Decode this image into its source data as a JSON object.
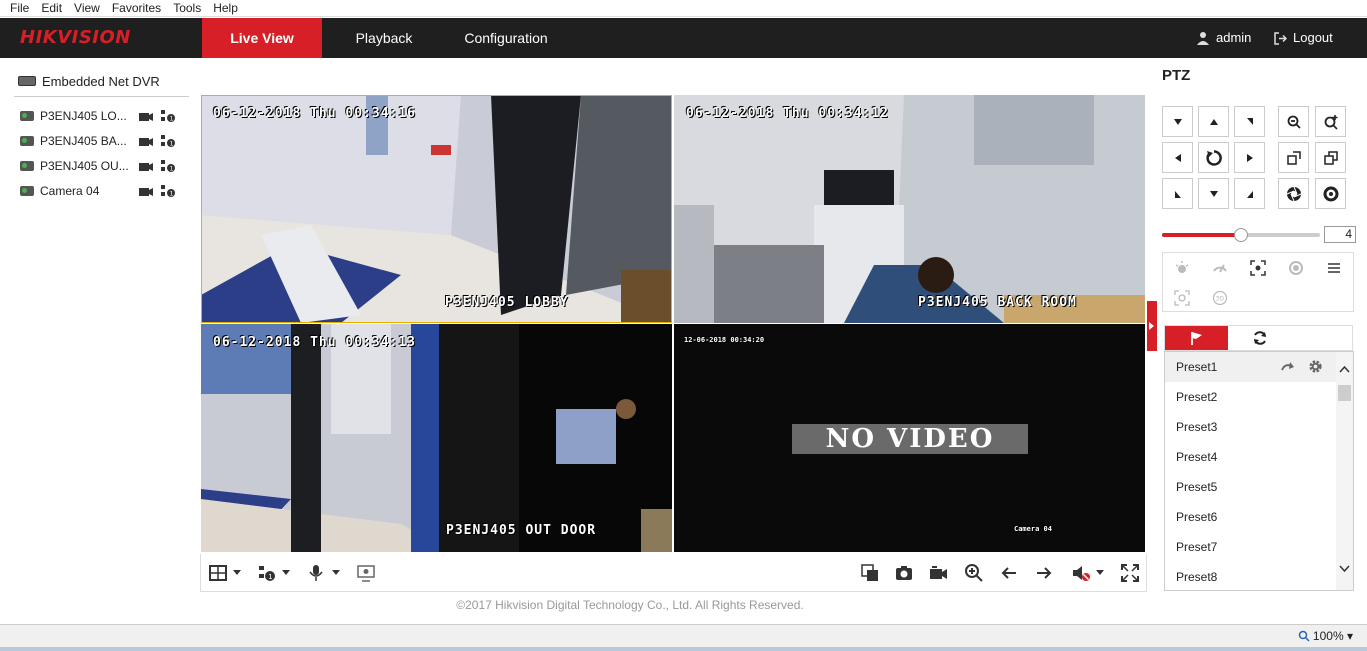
{
  "menubar": {
    "items": [
      "File",
      "Edit",
      "View",
      "Favorites",
      "Tools",
      "Help"
    ]
  },
  "brand": {
    "name": "HIKVISION",
    "accent": "#d61f26",
    "nav_bg": "#1f1f1f"
  },
  "nav": {
    "tabs": [
      {
        "label": "Live View",
        "active": true
      },
      {
        "label": "Playback",
        "active": false
      },
      {
        "label": "Configuration",
        "active": false
      }
    ],
    "user": "admin",
    "logout": "Logout"
  },
  "device_tree": {
    "root": "Embedded Net DVR",
    "cameras": [
      {
        "label": "P3ENJ405 LO..."
      },
      {
        "label": "P3ENJ405 BA..."
      },
      {
        "label": "P3ENJ405 OU..."
      },
      {
        "label": "Camera 04"
      }
    ]
  },
  "tiles": [
    {
      "timestamp": "06-12-2018 Thu 00:34:16",
      "name": "P3ENJ405 LOBBY",
      "selected": true
    },
    {
      "timestamp": "06-12-2018 Thu 00:34:12",
      "name": "P3ENJ405 BACK ROOM",
      "selected": false
    },
    {
      "timestamp": "06-12-2018 Thu 00:34:13",
      "name": "P3ENJ405 OUT DOOR",
      "selected": false
    },
    {
      "timestamp": "12-06-2018 00:34:20",
      "name": "Camera 04",
      "no_video": "NO VIDEO",
      "selected": false
    }
  ],
  "footer": "©2017 Hikvision Digital Technology Co., Ltd. All Rights Reserved.",
  "ptz": {
    "title": "PTZ",
    "speed": "4",
    "speed_level_fraction": 0.5,
    "presets": [
      "Preset1",
      "Preset2",
      "Preset3",
      "Preset4",
      "Preset5",
      "Preset6",
      "Preset7",
      "Preset8"
    ]
  },
  "status": {
    "zoom": "100%"
  }
}
